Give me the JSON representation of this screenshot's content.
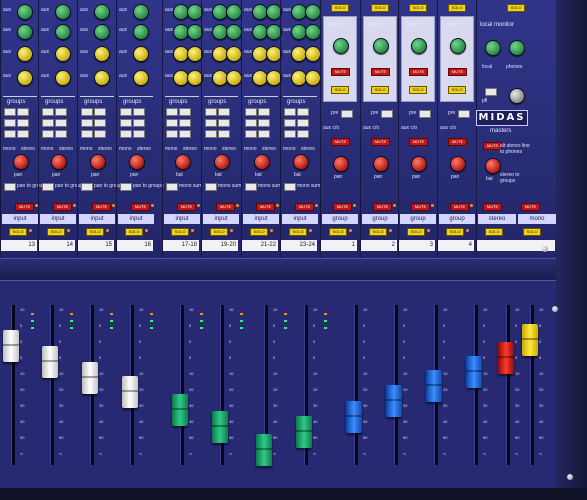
{
  "console": {
    "brand": "MIDAS",
    "aux_headers": [
      "aux 1",
      "aux 2",
      "aux 3",
      "aux 4"
    ],
    "local_monitor": "local monitor",
    "local_label": "local",
    "phones_label": "phones",
    "pfl_label": "pfl",
    "masters_label": "masters",
    "alt_stereo_label": "alt stereo line to phones",
    "stereo_to_groups": "stereo to groups",
    "aux_c_o": "aux c/o",
    "pre_label": "pre"
  },
  "input_strips": [
    {
      "number": "13",
      "name": "input"
    },
    {
      "number": "14",
      "name": "input"
    },
    {
      "number": "15",
      "name": "input"
    },
    {
      "number": "16",
      "name": "input"
    },
    {
      "number": "17-18",
      "name": "input"
    },
    {
      "number": "19-20",
      "name": "input"
    },
    {
      "number": "21-22",
      "name": "input"
    },
    {
      "number": "23-24",
      "name": "input"
    }
  ],
  "group_strips": [
    {
      "number": "1",
      "name": "group"
    },
    {
      "number": "2",
      "name": "group"
    },
    {
      "number": "3",
      "name": "group"
    },
    {
      "number": "4",
      "name": "group"
    }
  ],
  "master_strips": [
    {
      "name": "stereo"
    },
    {
      "name": "mono"
    }
  ],
  "labels": {
    "groups": "groups",
    "mono": "mono",
    "stereo": "stereo",
    "pan": "pan",
    "bal": "bal",
    "pan_to_groups": "pan to groups",
    "mono_sum": "mono sum",
    "mute": "MUTE",
    "solo": "SOLO",
    "aux": "aux"
  },
  "fader_scale": [
    "10",
    "5",
    "0",
    "5",
    "10",
    "20",
    "30",
    "40",
    "50",
    "∞"
  ],
  "fader_colors": {
    "mono_inputs": "#ffffff",
    "stereo_inputs": "#30c889",
    "groups": "#3d8cff",
    "stereo_master": "#ff3a2a",
    "mono_master": "#ffe83c"
  }
}
